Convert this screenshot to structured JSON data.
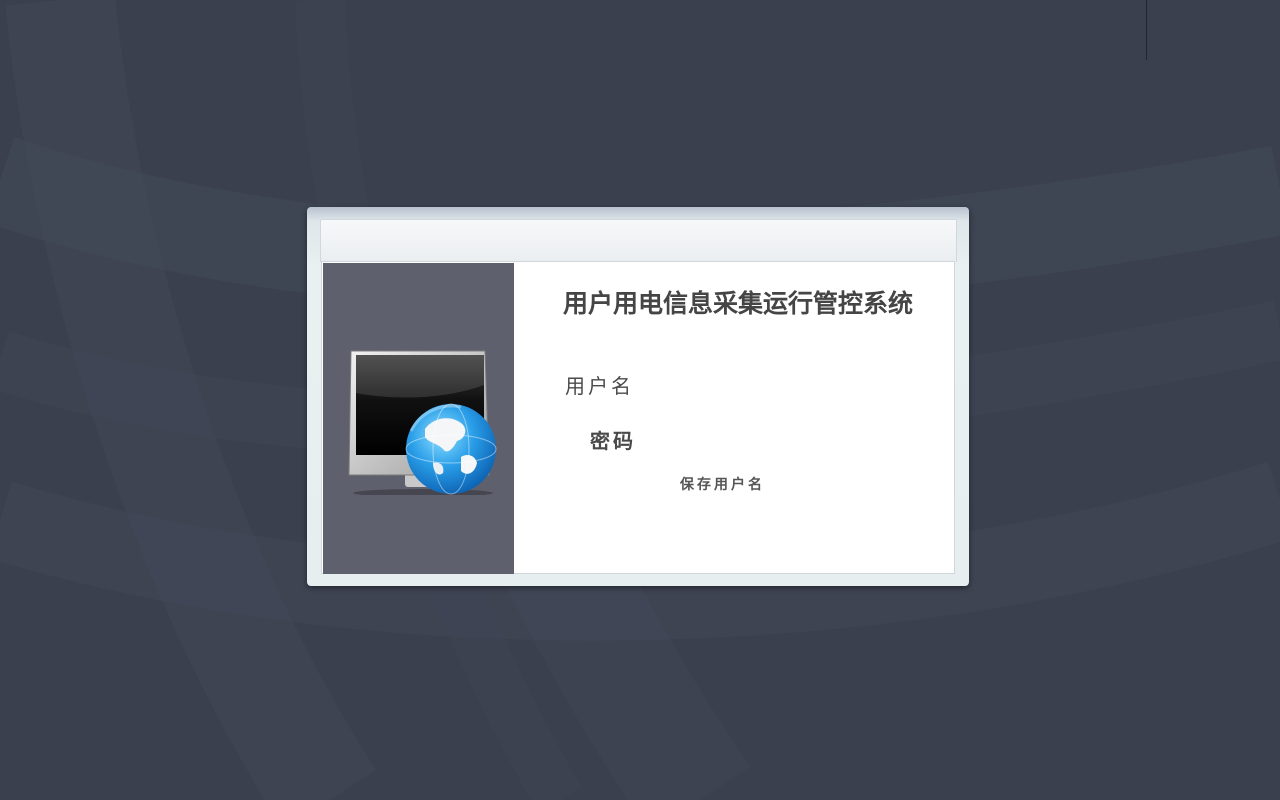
{
  "login": {
    "title": "用户用电信息采集运行管控系统",
    "username_label": "用户名",
    "password_label": "密码",
    "remember_label": "保存用户名",
    "username_value": "",
    "password_value": ""
  },
  "icons": {
    "login_graphic": "monitor-globe-icon"
  },
  "colors": {
    "background": "#3b404e",
    "left_panel": "#5e616d",
    "title_text": "#454545",
    "dialog_frame": "#e6eeef"
  }
}
